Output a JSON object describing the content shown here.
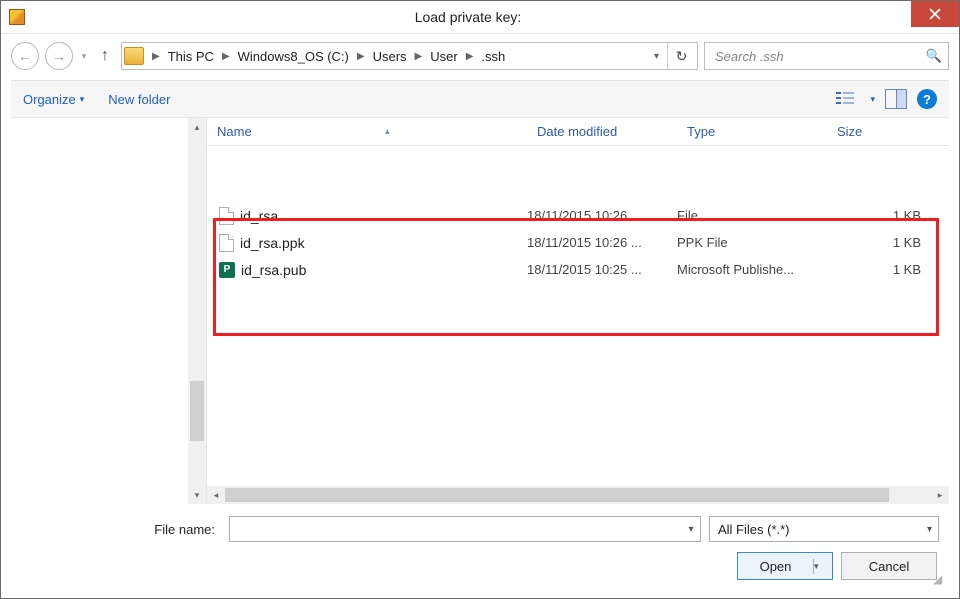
{
  "dialog": {
    "title": "Load private key:"
  },
  "nav": {
    "breadcrumb": [
      "This PC",
      "Windows8_OS (C:)",
      "Users",
      "User",
      ".ssh"
    ],
    "search_placeholder": "Search .ssh"
  },
  "toolbar": {
    "organize": "Organize",
    "new_folder": "New folder"
  },
  "columns": {
    "name": "Name",
    "date": "Date modified",
    "type": "Type",
    "size": "Size"
  },
  "files": [
    {
      "name": "id_rsa",
      "date": "18/11/2015 10:26 ...",
      "type": "File",
      "size": "1 KB",
      "icon": "file"
    },
    {
      "name": "id_rsa.ppk",
      "date": "18/11/2015 10:26 ...",
      "type": "PPK File",
      "size": "1 KB",
      "icon": "file"
    },
    {
      "name": "id_rsa.pub",
      "date": "18/11/2015 10:25 ...",
      "type": "Microsoft Publishe...",
      "size": "1 KB",
      "icon": "pub"
    }
  ],
  "bottom": {
    "filename_label": "File name:",
    "filename_value": "",
    "filetype_label": "All Files (*.*)",
    "open": "Open",
    "cancel": "Cancel"
  }
}
